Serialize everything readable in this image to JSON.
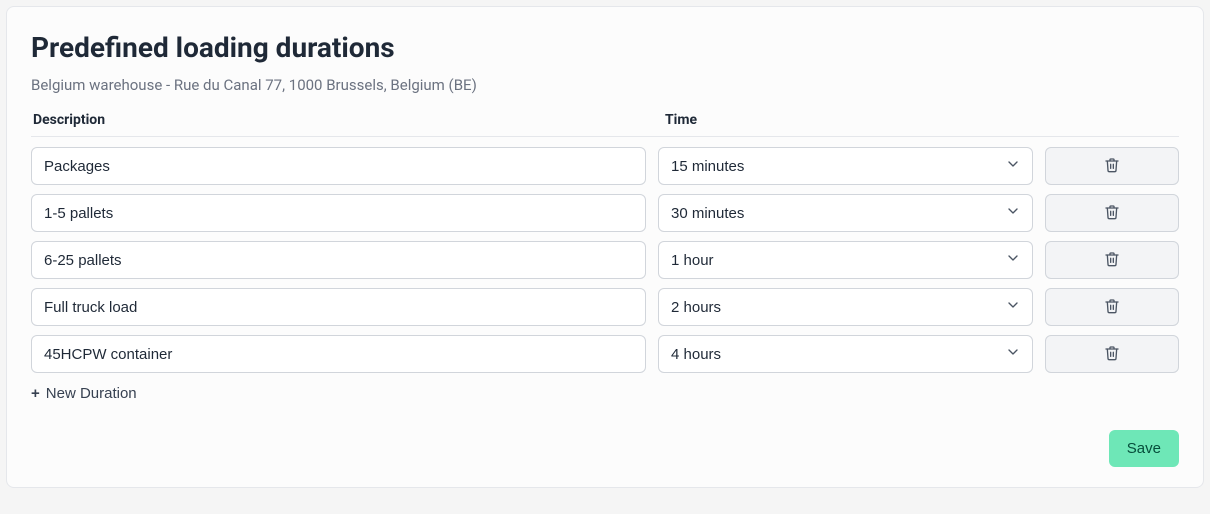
{
  "title": "Predefined loading durations",
  "subtitle": "Belgium warehouse - Rue du Canal 77, 1000 Brussels, Belgium (BE)",
  "columns": {
    "description": "Description",
    "time": "Time"
  },
  "rows": [
    {
      "description": "Packages",
      "time": "15 minutes"
    },
    {
      "description": "1-5 pallets",
      "time": "30 minutes"
    },
    {
      "description": "6-25 pallets",
      "time": "1 hour"
    },
    {
      "description": "Full truck load",
      "time": "2 hours"
    },
    {
      "description": "45HCPW container",
      "time": "4 hours"
    }
  ],
  "addLabel": "New Duration",
  "saveLabel": "Save"
}
